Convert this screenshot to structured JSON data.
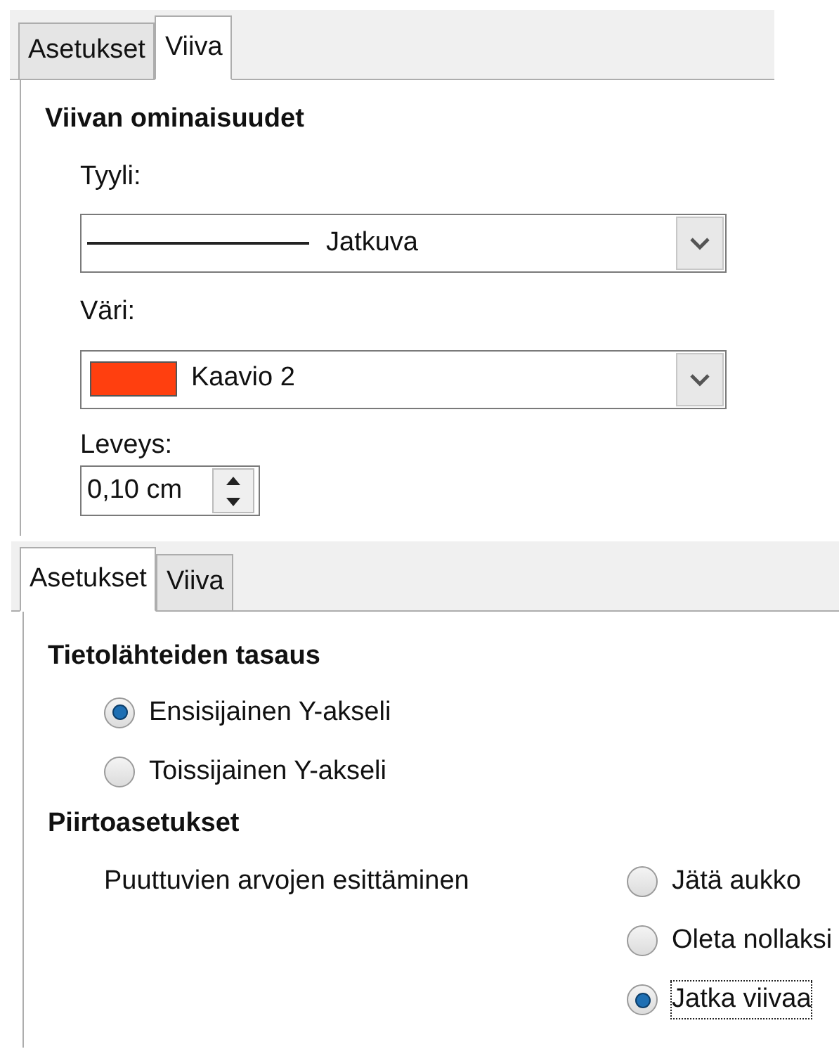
{
  "line_panel": {
    "tabs": [
      {
        "label": "Asetukset",
        "selected": false
      },
      {
        "label": "Viiva",
        "selected": true
      }
    ],
    "heading": "Viivan ominaisuudet",
    "style": {
      "label": "Tyyli:",
      "value": "Jatkuva"
    },
    "color": {
      "label": "Väri:",
      "value": "Kaavio 2",
      "color": "#ff3f0f"
    },
    "width": {
      "label": "Leveys:",
      "value": "0,10 cm"
    }
  },
  "options_panel": {
    "tabs": [
      {
        "label": "Asetukset",
        "selected": true
      },
      {
        "label": "Viiva",
        "selected": false
      }
    ],
    "alignment": {
      "heading": "Tietolähteiden tasaus",
      "options": [
        {
          "label": "Ensisijainen Y-akseli",
          "selected": true,
          "focused": false
        },
        {
          "label": "Toissijainen Y-akseli",
          "selected": false,
          "focused": false
        }
      ]
    },
    "plot": {
      "heading": "Piirtoasetukset",
      "missing_label": "Puuttuvien arvojen esittäminen",
      "options": [
        {
          "label": "Jätä aukko",
          "selected": false,
          "focused": false
        },
        {
          "label": "Oleta nollaksi",
          "selected": false,
          "focused": false
        },
        {
          "label": "Jatka viivaa",
          "selected": true,
          "focused": true
        }
      ]
    }
  }
}
